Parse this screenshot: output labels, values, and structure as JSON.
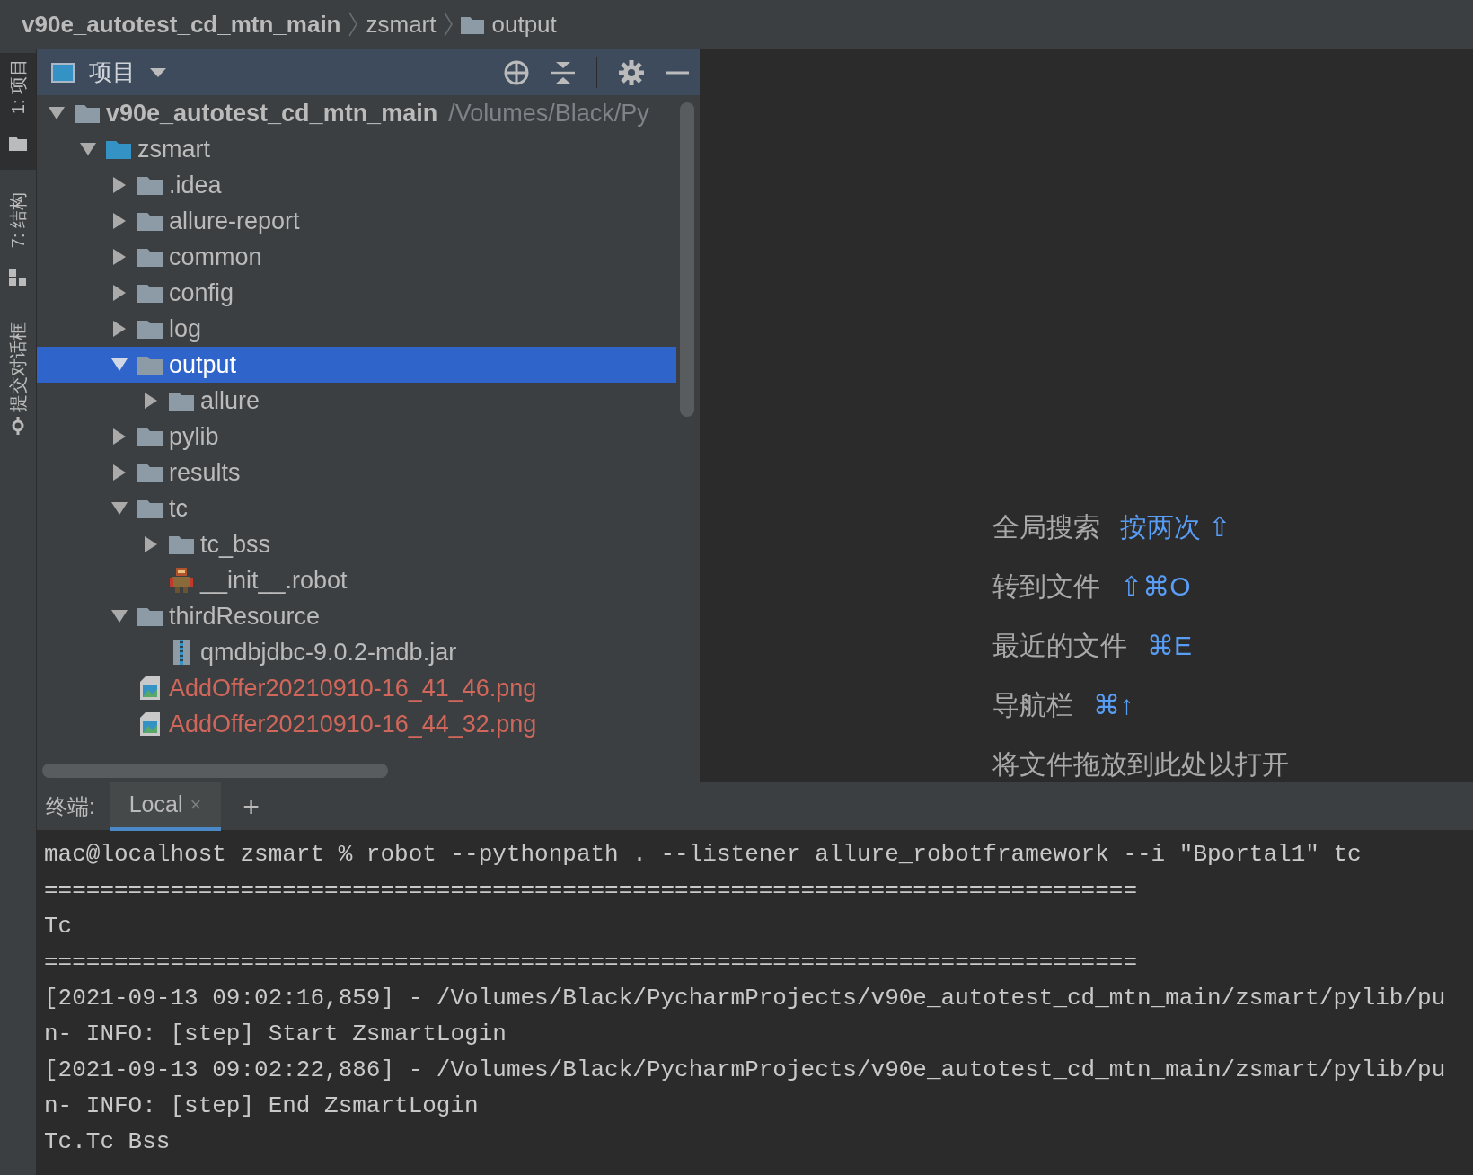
{
  "breadcrumb": [
    {
      "kind": "project",
      "label": "v90e_autotest_cd_mtn_main"
    },
    {
      "kind": "module",
      "label": "zsmart"
    },
    {
      "kind": "folder",
      "label": "output"
    }
  ],
  "tool_stripe": [
    {
      "kind": "project",
      "label": "1: 项目",
      "selected": true
    },
    {
      "kind": "structure",
      "label": "7: 结构",
      "selected": false
    },
    {
      "kind": "commit",
      "label": "提交对话框",
      "selected": false
    }
  ],
  "project_panel": {
    "title": "项目",
    "tree": [
      {
        "kind": "project",
        "name": "v90e_autotest_cd_mtn_main",
        "path": "/Volumes/Black/Py",
        "expanded": true,
        "selected": false,
        "untracked": false,
        "children": [
          {
            "kind": "source_folder",
            "name": "zsmart",
            "expanded": true,
            "selected": false,
            "untracked": false,
            "children": [
              {
                "kind": "folder",
                "name": ".idea",
                "expanded": false,
                "selected": false,
                "untracked": false
              },
              {
                "kind": "folder",
                "name": "allure-report",
                "expanded": false,
                "selected": false,
                "untracked": false
              },
              {
                "kind": "folder",
                "name": "common",
                "expanded": false,
                "selected": false,
                "untracked": false
              },
              {
                "kind": "folder",
                "name": "config",
                "expanded": false,
                "selected": false,
                "untracked": false
              },
              {
                "kind": "folder",
                "name": "log",
                "expanded": false,
                "selected": false,
                "untracked": false
              },
              {
                "kind": "folder",
                "name": "output",
                "expanded": true,
                "selected": true,
                "untracked": false,
                "children": [
                  {
                    "kind": "folder",
                    "name": "allure",
                    "expanded": false,
                    "selected": false,
                    "untracked": false
                  }
                ]
              },
              {
                "kind": "folder",
                "name": "pylib",
                "expanded": false,
                "selected": false,
                "untracked": false
              },
              {
                "kind": "folder",
                "name": "results",
                "expanded": false,
                "selected": false,
                "untracked": false
              },
              {
                "kind": "folder",
                "name": "tc",
                "expanded": true,
                "selected": false,
                "untracked": false,
                "children": [
                  {
                    "kind": "folder",
                    "name": "tc_bss",
                    "expanded": false,
                    "selected": false,
                    "untracked": false
                  },
                  {
                    "kind": "robot",
                    "name": "__init__.robot",
                    "selected": false,
                    "untracked": false
                  }
                ]
              },
              {
                "kind": "folder",
                "name": "thirdResource",
                "expanded": true,
                "selected": false,
                "untracked": false,
                "children": [
                  {
                    "kind": "jar",
                    "name": "qmdbjdbc-9.0.2-mdb.jar",
                    "selected": false,
                    "untracked": false
                  }
                ]
              },
              {
                "kind": "image",
                "name": "AddOffer20210910-16_41_46.png",
                "selected": false,
                "untracked": true
              },
              {
                "kind": "image",
                "name": "AddOffer20210910-16_44_32.png",
                "selected": false,
                "untracked": true
              }
            ]
          }
        ]
      }
    ]
  },
  "editor_hints": [
    {
      "label": "全局搜索",
      "shortcut": "按两次 ⇧"
    },
    {
      "label": "转到文件",
      "shortcut": "⇧⌘O"
    },
    {
      "label": "最近的文件",
      "shortcut": "⌘E"
    },
    {
      "label": "导航栏",
      "shortcut": "⌘↑"
    },
    {
      "label": "将文件拖放到此处以打开"
    }
  ],
  "terminal": {
    "title": "终端:",
    "tabs": [
      {
        "label": "Local",
        "close": "×",
        "selected": true
      }
    ],
    "add": "+",
    "lines": [
      "mac@localhost zsmart % robot --pythonpath . --listener allure_robotframework --i \"Bportal1\" tc",
      "==============================================================================",
      "Tc",
      "==============================================================================",
      "[2021-09-13 09:02:16,859] - /Volumes/Black/PycharmProjects/v90e_autotest_cd_mtn_main/zsmart/pylib/pu",
      "n- INFO: [step] Start ZsmartLogin",
      "[2021-09-13 09:02:22,886] - /Volumes/Black/PycharmProjects/v90e_autotest_cd_mtn_main/zsmart/pylib/pu",
      "n- INFO: [step] End ZsmartLogin",
      "Tc.Tc Bss"
    ]
  }
}
